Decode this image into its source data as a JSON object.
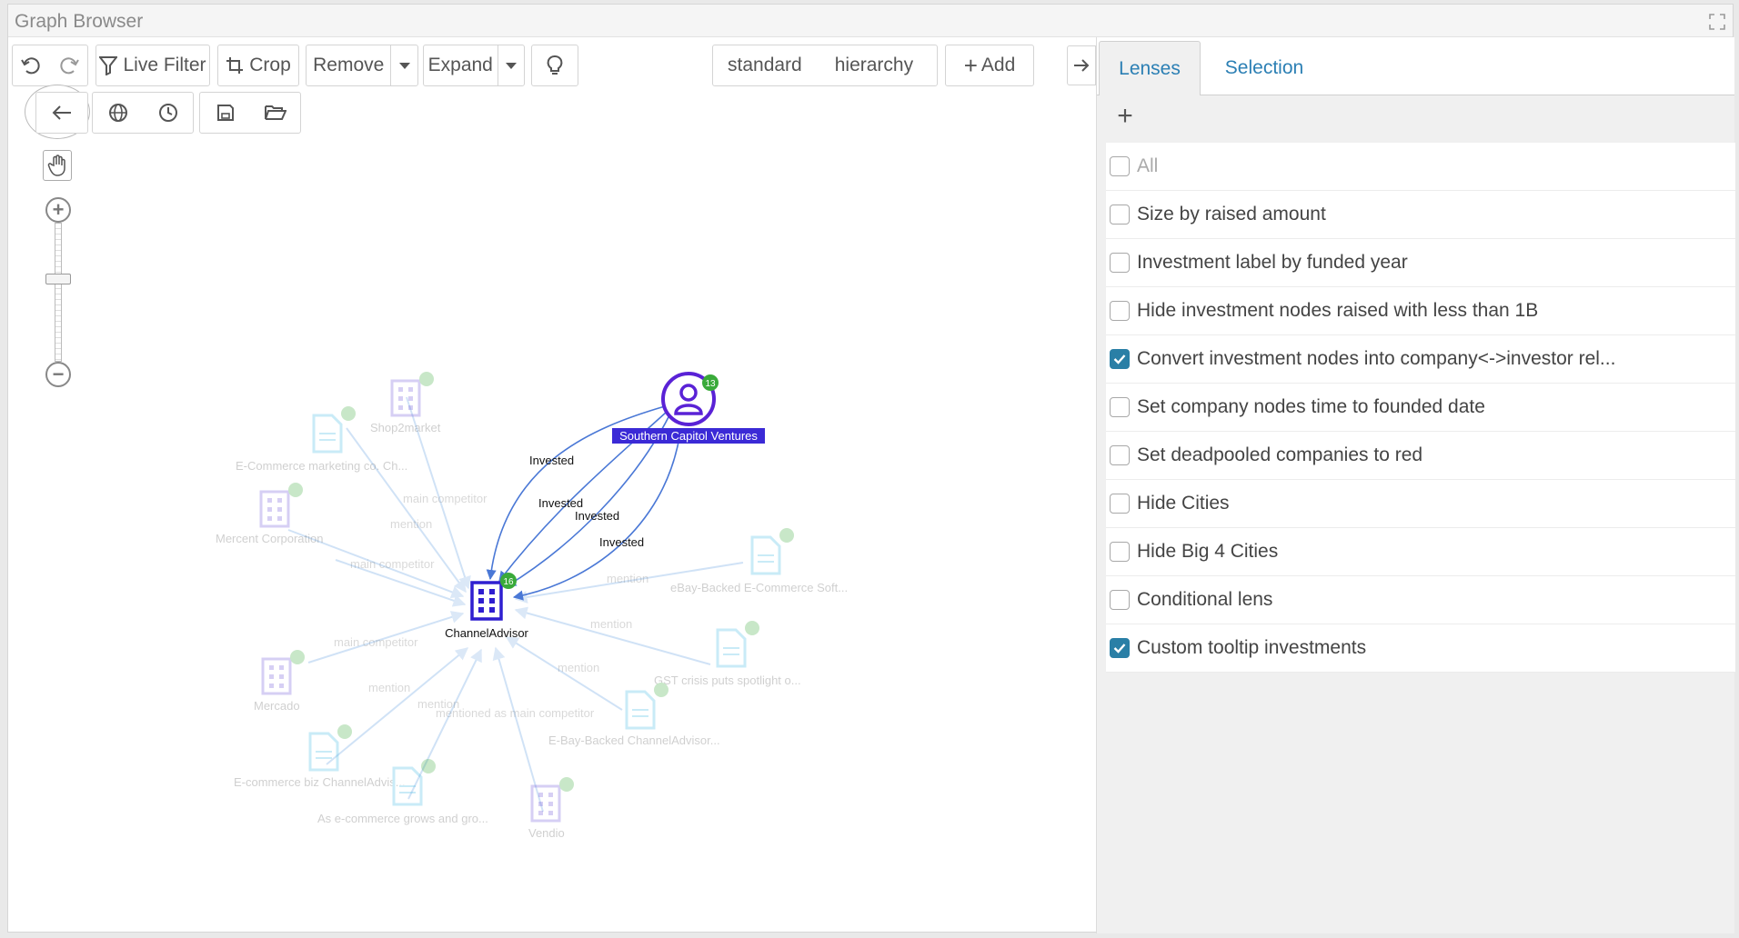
{
  "window": {
    "title": "Graph Browser"
  },
  "toolbar": {
    "live_filter": "Live Filter",
    "crop": "Crop",
    "remove": "Remove",
    "expand": "Expand",
    "mode_standard": "standard",
    "mode_hierarchy": "hierarchy",
    "add": "Add"
  },
  "tabs": {
    "lenses": "Lenses",
    "selection": "Selection"
  },
  "lenses": [
    {
      "label": "All",
      "checked": false,
      "dim": true
    },
    {
      "label": "Size by raised amount",
      "checked": false
    },
    {
      "label": "Investment label by funded year",
      "checked": false
    },
    {
      "label": "Hide investment nodes raised with less than 1B",
      "checked": false
    },
    {
      "label": "Convert investment nodes into company<->investor rel...",
      "checked": true
    },
    {
      "label": "Set company nodes time to founded date",
      "checked": false
    },
    {
      "label": "Set deadpooled companies to red",
      "checked": false
    },
    {
      "label": "Hide Cities",
      "checked": false
    },
    {
      "label": "Hide Big 4 Cities",
      "checked": false
    },
    {
      "label": "Conditional lens",
      "checked": false
    },
    {
      "label": "Custom tooltip investments",
      "checked": true
    }
  ],
  "graph": {
    "center": {
      "label": "ChannelAdvisor",
      "badge": "16"
    },
    "investor": {
      "label": "Southern Capitol Ventures",
      "badge": "13"
    },
    "invested_edges": [
      "Invested",
      "Invested",
      "Invested",
      "Invested"
    ],
    "ghost_nodes": [
      {
        "label": "Shop2market",
        "badge": "4"
      },
      {
        "label": "E-Commerce marketing co. Ch...",
        "badge": "4"
      },
      {
        "label": "Mercent Corporation",
        "badge": "4"
      },
      {
        "label": "eBay-Backed E-Commerce Soft...",
        "badge": "4"
      },
      {
        "label": "GST crisis puts spotlight o...",
        "badge": "4"
      },
      {
        "label": "E-Bay-Backed ChannelAdvisor...",
        "badge": "4"
      },
      {
        "label": "Mercado",
        "badge": "4"
      },
      {
        "label": "E-commerce biz ChannelAdvis...",
        "badge": "4"
      },
      {
        "label": "As e-commerce grows and gro...",
        "badge": "4"
      },
      {
        "label": "Vendio",
        "badge": "4"
      }
    ],
    "ghost_edges": [
      "main competitor",
      "mention",
      "main competitor",
      "mention",
      "mention",
      "main competitor",
      "mention",
      "mention",
      "mention",
      "mentioned as main competitor"
    ]
  },
  "colors": {
    "accent": "#2a7fa6",
    "investor": "#5a22d6",
    "company": "#2f1fd0",
    "badge": "#3aaa3a",
    "doc": "#4fc7e6"
  }
}
